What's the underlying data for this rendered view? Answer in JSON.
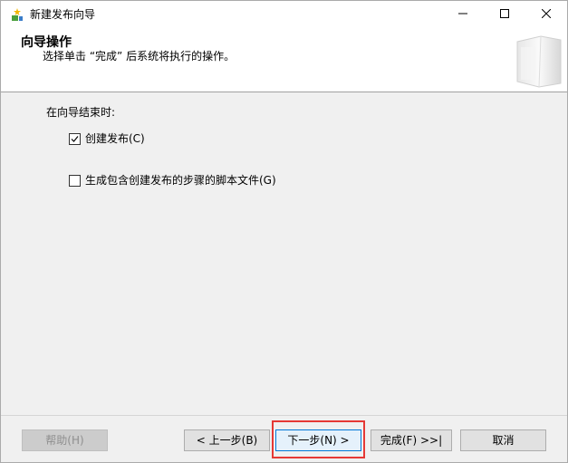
{
  "window": {
    "title": "新建发布向导",
    "app_icon": "wizard-icon"
  },
  "header": {
    "title": "向导操作",
    "subtitle": "选择单击 “完成” 后系统将执行的操作。",
    "art_icon": "wizard-banner-graphic"
  },
  "main": {
    "group_label": "在向导结束时:",
    "options": [
      {
        "label": "创建发布(C)",
        "checked": true
      },
      {
        "label": "生成包含创建发布的步骤的脚本文件(G)",
        "checked": false
      }
    ]
  },
  "footer": {
    "help_label": "帮助(H)",
    "back_label": "< 上一步(B)",
    "next_label": "下一步(N) >",
    "finish_label": "完成(F) >>|",
    "cancel_label": "取消"
  },
  "colors": {
    "highlight": "#e53935",
    "default_button_border": "#0078d7",
    "dialog_background": "#f0f0f0"
  }
}
